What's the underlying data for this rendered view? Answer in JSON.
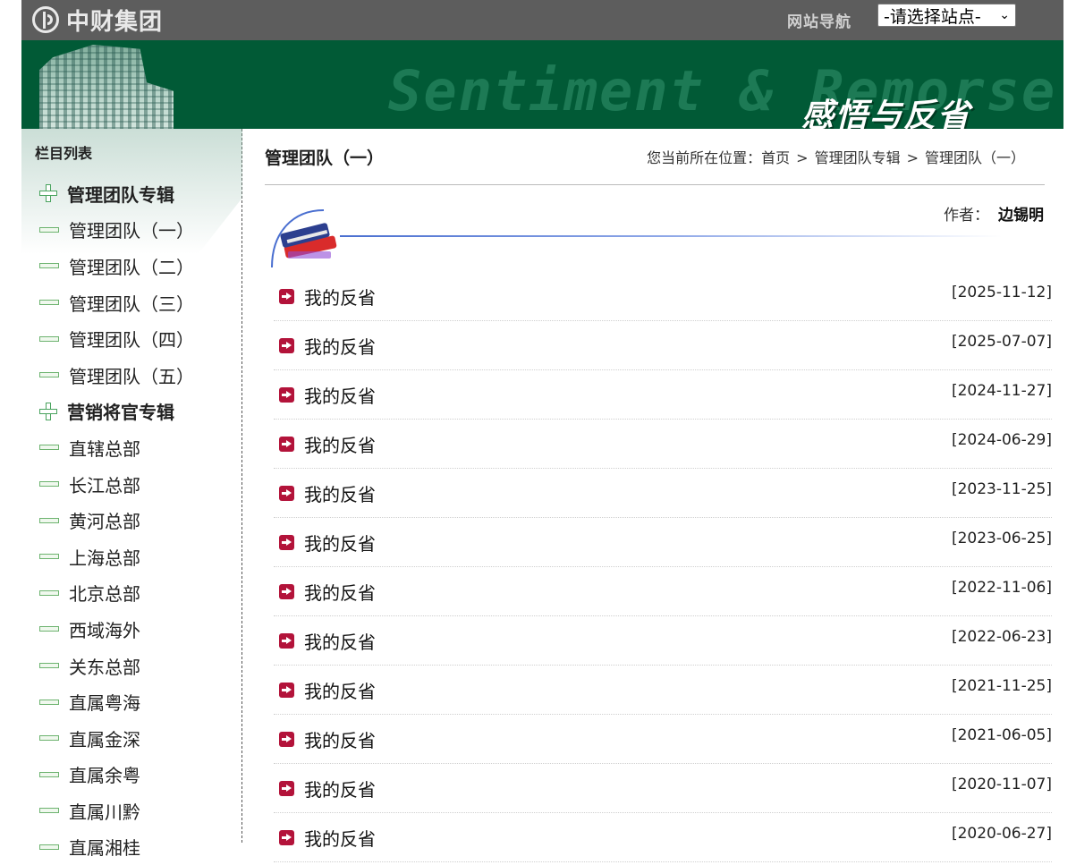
{
  "header": {
    "logo_text": "中财集团",
    "nav_label": "网站导航",
    "site_select_value": "-请选择站点-"
  },
  "banner": {
    "watermark": "Sentiment & Remorse",
    "title": "感悟与反省"
  },
  "sidebar": {
    "title": "栏目列表",
    "items": [
      {
        "label": "管理团队专辑",
        "type": "category"
      },
      {
        "label": "管理团队（一）",
        "type": "item"
      },
      {
        "label": "管理团队（二）",
        "type": "item"
      },
      {
        "label": "管理团队（三）",
        "type": "item"
      },
      {
        "label": "管理团队（四）",
        "type": "item"
      },
      {
        "label": "管理团队（五）",
        "type": "item"
      },
      {
        "label": "营销将官专辑",
        "type": "category"
      },
      {
        "label": "直辖总部",
        "type": "item"
      },
      {
        "label": "长江总部",
        "type": "item"
      },
      {
        "label": "黄河总部",
        "type": "item"
      },
      {
        "label": "上海总部",
        "type": "item"
      },
      {
        "label": "北京总部",
        "type": "item"
      },
      {
        "label": "西域海外",
        "type": "item"
      },
      {
        "label": "关东总部",
        "type": "item"
      },
      {
        "label": "直属粤海",
        "type": "item"
      },
      {
        "label": "直属金深",
        "type": "item"
      },
      {
        "label": "直属余粤",
        "type": "item"
      },
      {
        "label": "直属川黔",
        "type": "item"
      },
      {
        "label": "直属湘桂",
        "type": "item"
      }
    ]
  },
  "main": {
    "page_title": "管理团队（一）",
    "breadcrumb": {
      "prefix": "您当前所在位置：",
      "items": [
        "首页",
        "管理团队专辑",
        "管理团队（一）"
      ],
      "separator": ">"
    },
    "author_label": "作者：",
    "author_name": "边锡明",
    "articles": [
      {
        "title": "我的反省",
        "date": "[2025-11-12]"
      },
      {
        "title": "我的反省",
        "date": "[2025-07-07]"
      },
      {
        "title": "我的反省",
        "date": "[2024-11-27]"
      },
      {
        "title": "我的反省",
        "date": "[2024-06-29]"
      },
      {
        "title": "我的反省",
        "date": "[2023-11-25]"
      },
      {
        "title": "我的反省",
        "date": "[2023-06-25]"
      },
      {
        "title": "我的反省",
        "date": "[2022-11-06]"
      },
      {
        "title": "我的反省",
        "date": "[2022-06-23]"
      },
      {
        "title": "我的反省",
        "date": "[2021-11-25]"
      },
      {
        "title": "我的反省",
        "date": "[2021-06-05]"
      },
      {
        "title": "我的反省",
        "date": "[2020-11-07]"
      },
      {
        "title": "我的反省",
        "date": "[2020-06-27]"
      }
    ]
  },
  "colors": {
    "topbar": "#5d5d5d",
    "banner": "#015a36",
    "arrow": "#b3133a",
    "sidebar_icon": "#49a35e"
  },
  "icons": {
    "category": "plus-icon",
    "item": "dash-icon",
    "article": "arrow-right-icon",
    "author": "book-icon"
  }
}
